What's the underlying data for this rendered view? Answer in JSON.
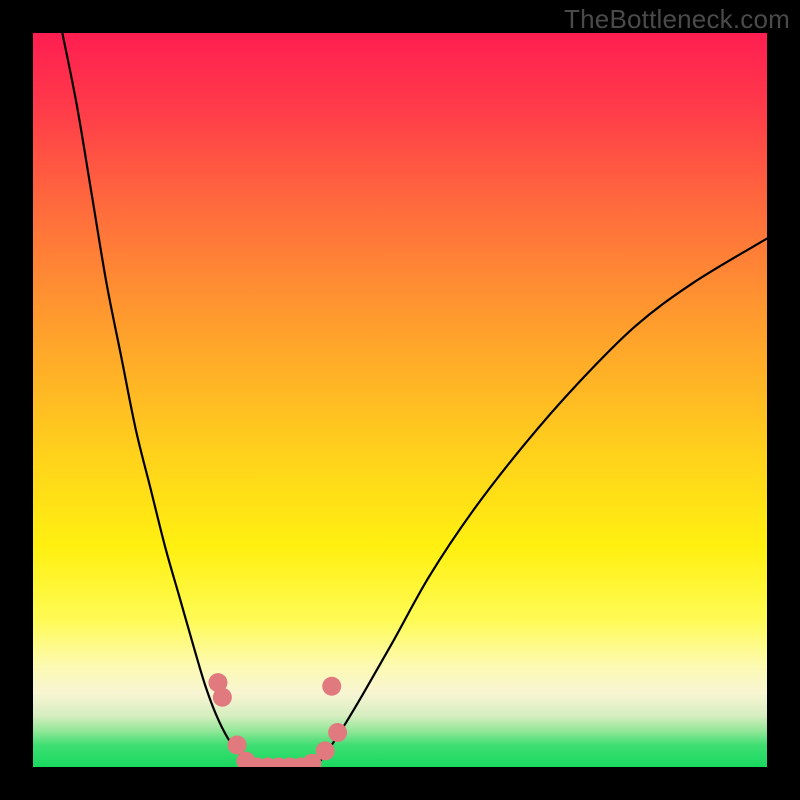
{
  "watermark": "TheBottleneck.com",
  "chart_data": {
    "type": "line",
    "title": "",
    "xlabel": "",
    "ylabel": "",
    "xlim": [
      0,
      100
    ],
    "ylim": [
      0,
      100
    ],
    "grid": false,
    "background_gradient": {
      "top": "#ff1e51",
      "bottom": "#18d95f",
      "stops": [
        "#ff1e51",
        "#ff653e",
        "#ffb027",
        "#fff010",
        "#fdfab0",
        "#3fde72"
      ]
    },
    "series": [
      {
        "name": "left-branch",
        "x": [
          4,
          6,
          8,
          10,
          12,
          14,
          16,
          18,
          20,
          22,
          23.5,
          25,
          26.5,
          28,
          29,
          29.8
        ],
        "y": [
          100,
          90,
          78,
          66,
          56,
          46,
          38,
          30,
          23,
          16,
          11,
          7,
          4,
          2,
          1,
          0
        ]
      },
      {
        "name": "valley-floor",
        "x": [
          29.8,
          31,
          33,
          35,
          37,
          38.5
        ],
        "y": [
          0,
          0,
          0,
          0,
          0,
          0
        ]
      },
      {
        "name": "right-branch",
        "x": [
          38.5,
          40,
          42,
          45,
          49,
          54,
          60,
          67,
          74,
          82,
          90,
          100
        ],
        "y": [
          0,
          2,
          5,
          10,
          17,
          26,
          35,
          44,
          52,
          60,
          66,
          72
        ]
      }
    ],
    "markers": {
      "name": "highlight-dots",
      "color": "#e07a7f",
      "points": [
        {
          "x": 25.2,
          "y": 11.5
        },
        {
          "x": 25.8,
          "y": 9.5
        },
        {
          "x": 27.8,
          "y": 3.0
        },
        {
          "x": 29.0,
          "y": 0.8
        },
        {
          "x": 30.5,
          "y": 0.0
        },
        {
          "x": 32.0,
          "y": 0.0
        },
        {
          "x": 33.5,
          "y": 0.0
        },
        {
          "x": 35.0,
          "y": 0.0
        },
        {
          "x": 36.5,
          "y": 0.0
        },
        {
          "x": 38.0,
          "y": 0.5
        },
        {
          "x": 39.8,
          "y": 2.2
        },
        {
          "x": 41.5,
          "y": 4.7
        },
        {
          "x": 40.7,
          "y": 11.0
        }
      ]
    }
  }
}
